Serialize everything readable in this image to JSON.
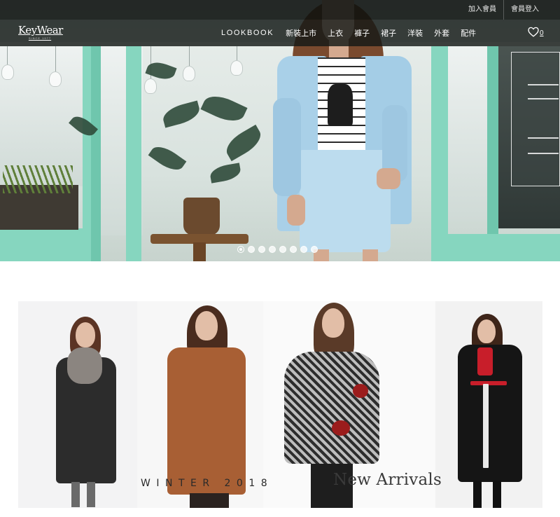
{
  "header": {
    "member_links": [
      {
        "label": "加入會員"
      },
      {
        "label": "會員登入"
      }
    ],
    "logo": {
      "name": "KeyWear",
      "tagline": "SINCE 1977"
    },
    "nav": [
      {
        "label": "LOOKBOOK"
      },
      {
        "label": "新裝上市"
      },
      {
        "label": "上衣"
      },
      {
        "label": "褲子"
      },
      {
        "label": "裙子"
      },
      {
        "label": "洋裝"
      },
      {
        "label": "外套"
      },
      {
        "label": "配件"
      }
    ],
    "wishlist": {
      "icon": "heart-icon",
      "count": "0"
    }
  },
  "hero": {
    "slides_total": 8,
    "active_slide": 1,
    "shop_sign_fragments": [
      "MONDAY &",
      "8:00 AM —",
      "SUNDAY &",
      "8:00 AM —"
    ]
  },
  "banner": {
    "season": "WINTER 2018",
    "headline": "New Arrivals"
  }
}
